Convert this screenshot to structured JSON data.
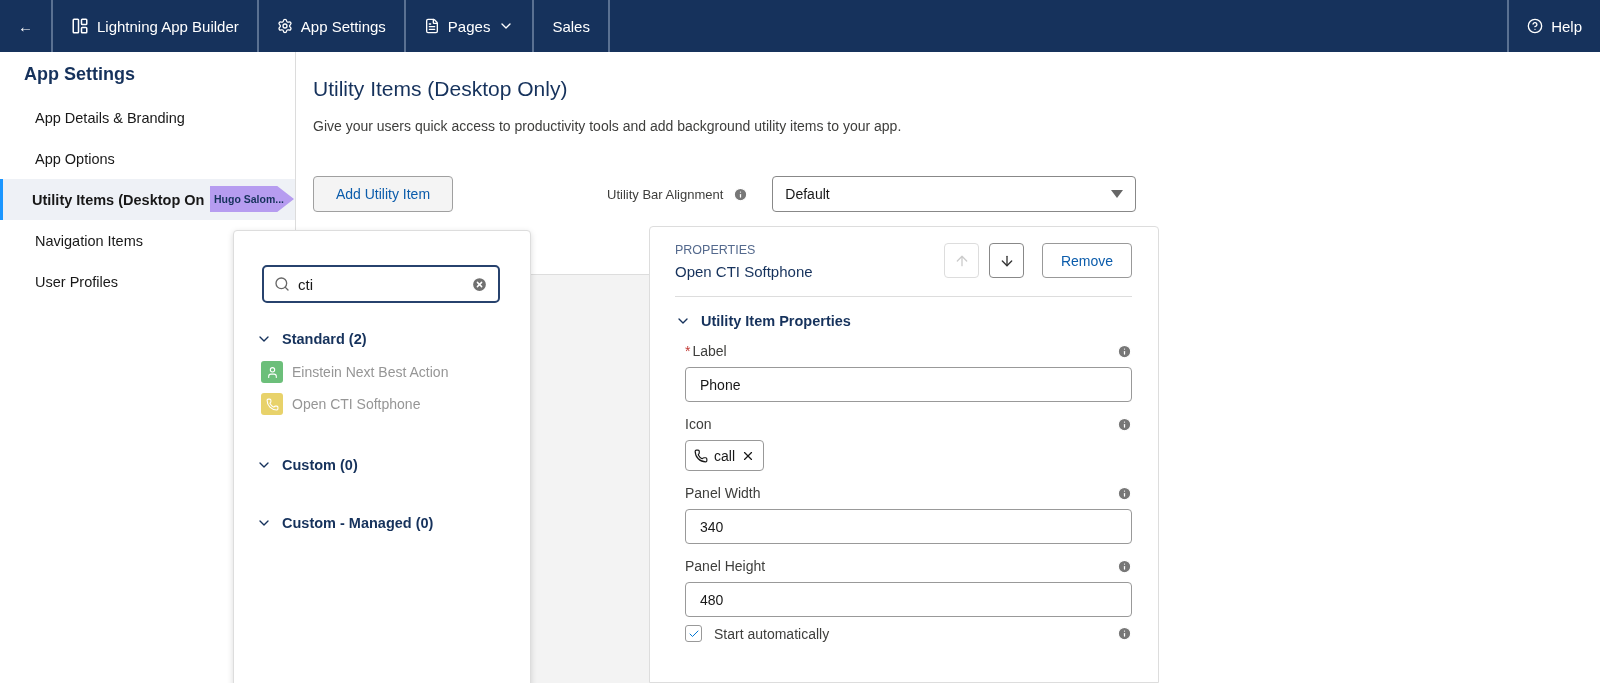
{
  "top_bar": {
    "back": "←",
    "items": [
      {
        "kind": "builder",
        "label": "Lightning App Builder"
      },
      {
        "kind": "settings",
        "label": "App Settings"
      },
      {
        "kind": "pages",
        "label": "Pages"
      },
      {
        "kind": "plain",
        "label": "Sales"
      }
    ],
    "help": "Help"
  },
  "sidebar": {
    "title": "App Settings",
    "items": [
      {
        "label": "App Details & Branding",
        "selected": false
      },
      {
        "label": "App Options",
        "selected": false
      },
      {
        "label": "Utility Items (Desktop On",
        "selected": true
      },
      {
        "label": "Navigation Items",
        "selected": false
      },
      {
        "label": "User Profiles",
        "selected": false
      }
    ]
  },
  "pointer_tag": "Hugo Salom...",
  "main": {
    "title": "Utility Items (Desktop Only)",
    "description": "Give your users quick access to productivity tools and add background utility items to your app.",
    "add_button": "Add Utility Item",
    "alignment": {
      "label": "Utility Bar Alignment",
      "value": "Default"
    }
  },
  "popover": {
    "search": "cti",
    "groups": [
      {
        "label": "Standard (2)",
        "expanded": true,
        "items": [
          {
            "label": "Einstein Next Best Action",
            "color": "#6cbf7a"
          },
          {
            "label": "Open CTI Softphone",
            "color": "#e8d26a"
          }
        ]
      },
      {
        "label": "Custom (0)",
        "expanded": true
      },
      {
        "label": "Custom - Managed (0)",
        "expanded": true
      }
    ]
  },
  "properties": {
    "heading": "PROPERTIES",
    "name": "Open CTI Softphone",
    "remove": "Remove",
    "section": "Utility Item Properties",
    "label_field": {
      "label": "Label",
      "required_mark": "*",
      "value": "Phone"
    },
    "icon_field": {
      "label": "Icon",
      "value": "call"
    },
    "width_field": {
      "label": "Panel Width",
      "value": "340"
    },
    "height_field": {
      "label": "Panel Height",
      "value": "480"
    },
    "start_automatically": {
      "label": "Start automatically",
      "checked": true
    }
  }
}
